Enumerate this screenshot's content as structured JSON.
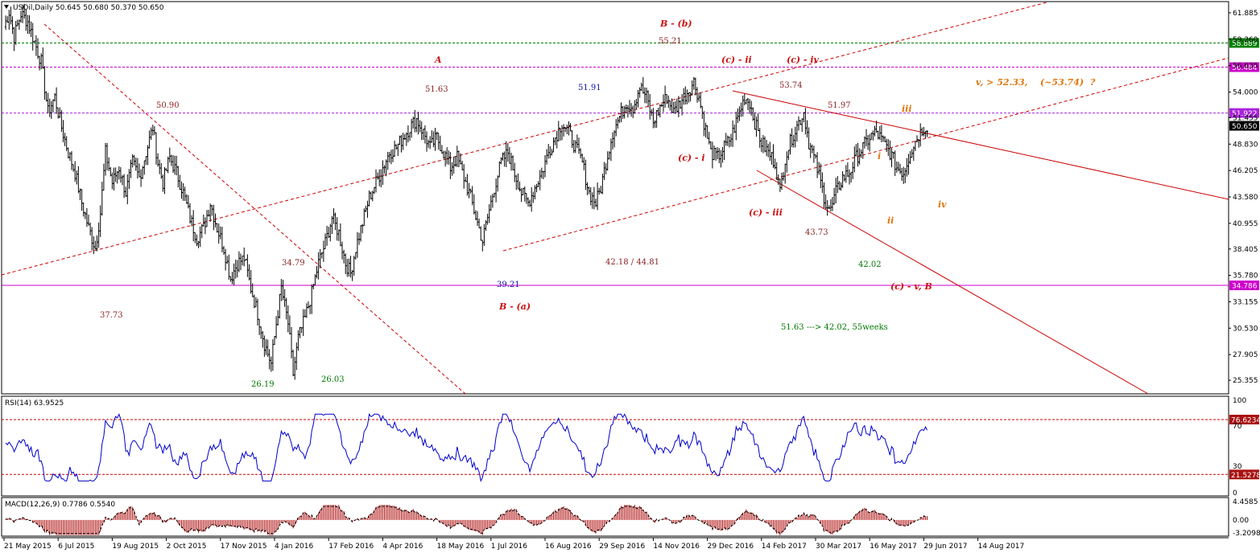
{
  "header": {
    "main_title": "USOil,Daily  50.645 50.680 50.370 50.650",
    "rsi_title": "RSI(14) 63.9525",
    "macd_title": "MACD(12,26,9) 0.7786 0.5540"
  },
  "colors": {
    "price": "#000000",
    "level_green": "#008000",
    "level_magenta": "#cc00cc",
    "level_purple": "#aa22dd",
    "trend_red": "#cc0000",
    "ann_red": "#cc1111",
    "ann_dark": "#8b2222",
    "ann_blue": "#1111aa",
    "ann_green": "#007700",
    "ann_orange": "#dd7711",
    "rsi_line": "#0000cc",
    "macd_hist": "#aa0000",
    "macd_signal": "#000000"
  },
  "chart_data": [
    {
      "type": "line",
      "panel": "price",
      "symbol": "USOil,Daily",
      "ylim": [
        24.0,
        63.0
      ],
      "y_ticks": [
        "61.885",
        "59.260",
        "56.635",
        "54.000",
        "51.455",
        "48.830",
        "46.205",
        "43.580",
        "40.955",
        "38.405",
        "35.780",
        "33.155",
        "30.530",
        "27.905",
        "25.355"
      ],
      "x_ticks": [
        "21 May 2015",
        "6 Jul 2015",
        "19 Aug 2015",
        "2 Oct 2015",
        "17 Nov 2015",
        "4 Jan 2016",
        "17 Feb 2016",
        "4 Apr 2016",
        "18 May 2016",
        "1 Jul 2016",
        "16 Aug 2016",
        "29 Sep 2016",
        "14 Nov 2016",
        "29 Dec 2016",
        "14 Feb 2017",
        "30 Mar 2017",
        "16 May 2017",
        "29 Jun 2017",
        "14 Aug 2017"
      ],
      "x_tick_index": [
        0,
        32,
        64,
        96,
        128,
        160,
        192,
        224,
        256,
        288,
        320,
        352,
        384,
        416,
        448,
        480,
        512,
        544,
        576
      ],
      "price_path_anchors": [
        [
          0,
          60.5
        ],
        [
          3,
          62.0
        ],
        [
          6,
          59.5
        ],
        [
          10,
          61.8
        ],
        [
          14,
          61.0
        ],
        [
          18,
          59.0
        ],
        [
          22,
          57.0
        ],
        [
          26,
          52.0
        ],
        [
          30,
          53.5
        ],
        [
          34,
          50.5
        ],
        [
          38,
          48.0
        ],
        [
          42,
          46.0
        ],
        [
          46,
          43.0
        ],
        [
          50,
          40.5
        ],
        [
          54,
          38.5
        ],
        [
          57,
          42.0
        ],
        [
          60,
          48.0
        ],
        [
          64,
          45.0
        ],
        [
          68,
          46.5
        ],
        [
          72,
          44.0
        ],
        [
          76,
          47.0
        ],
        [
          80,
          45.5
        ],
        [
          84,
          48.0
        ],
        [
          88,
          50.5
        ],
        [
          91,
          47.0
        ],
        [
          94,
          45.0
        ],
        [
          98,
          47.5
        ],
        [
          102,
          46.0
        ],
        [
          106,
          44.0
        ],
        [
          110,
          41.5
        ],
        [
          114,
          39.5
        ],
        [
          118,
          40.5
        ],
        [
          122,
          43.0
        ],
        [
          126,
          40.5
        ],
        [
          130,
          38.5
        ],
        [
          134,
          35.5
        ],
        [
          138,
          37.0
        ],
        [
          142,
          37.5
        ],
        [
          146,
          34.5
        ],
        [
          150,
          32.0
        ],
        [
          154,
          29.0
        ],
        [
          158,
          27.0
        ],
        [
          161,
          31.0
        ],
        [
          164,
          34.5
        ],
        [
          168,
          31.0
        ],
        [
          171,
          26.0
        ],
        [
          174,
          29.5
        ],
        [
          178,
          31.5
        ],
        [
          182,
          34.0
        ],
        [
          186,
          37.0
        ],
        [
          190,
          39.0
        ],
        [
          194,
          41.5
        ],
        [
          198,
          40.0
        ],
        [
          202,
          37.0
        ],
        [
          205,
          36.0
        ],
        [
          208,
          38.5
        ],
        [
          212,
          41.0
        ],
        [
          216,
          43.5
        ],
        [
          220,
          45.0
        ],
        [
          224,
          46.5
        ],
        [
          228,
          48.0
        ],
        [
          232,
          48.5
        ],
        [
          236,
          49.5
        ],
        [
          240,
          50.5
        ],
        [
          244,
          51.3
        ],
        [
          248,
          50.0
        ],
        [
          252,
          48.5
        ],
        [
          256,
          49.5
        ],
        [
          260,
          48.0
        ],
        [
          264,
          46.5
        ],
        [
          268,
          47.5
        ],
        [
          272,
          45.5
        ],
        [
          276,
          43.5
        ],
        [
          280,
          41.0
        ],
        [
          283,
          39.2
        ],
        [
          286,
          41.5
        ],
        [
          290,
          44.5
        ],
        [
          294,
          47.0
        ],
        [
          298,
          48.0
        ],
        [
          302,
          46.0
        ],
        [
          306,
          44.0
        ],
        [
          310,
          43.0
        ],
        [
          314,
          44.5
        ],
        [
          318,
          46.0
        ],
        [
          322,
          48.0
        ],
        [
          326,
          49.5
        ],
        [
          330,
          51.0
        ],
        [
          334,
          50.0
        ],
        [
          338,
          48.5
        ],
        [
          342,
          47.0
        ],
        [
          346,
          44.0
        ],
        [
          350,
          43.0
        ],
        [
          353,
          44.5
        ],
        [
          356,
          47.0
        ],
        [
          360,
          50.0
        ],
        [
          364,
          51.5
        ],
        [
          368,
          53.0
        ],
        [
          372,
          52.5
        ],
        [
          376,
          54.5
        ],
        [
          380,
          53.5
        ],
        [
          384,
          51.0
        ],
        [
          388,
          52.5
        ],
        [
          392,
          53.5
        ],
        [
          396,
          52.0
        ],
        [
          400,
          53.0
        ],
        [
          404,
          54.0
        ],
        [
          408,
          55.0
        ],
        [
          411,
          53.5
        ],
        [
          414,
          51.0
        ],
        [
          418,
          48.0
        ],
        [
          422,
          47.5
        ],
        [
          426,
          48.5
        ],
        [
          430,
          49.5
        ],
        [
          434,
          51.5
        ],
        [
          438,
          53.5
        ],
        [
          441,
          53.0
        ],
        [
          444,
          51.0
        ],
        [
          448,
          49.0
        ],
        [
          452,
          48.0
        ],
        [
          456,
          47.0
        ],
        [
          459,
          44.0
        ],
        [
          462,
          47.5
        ],
        [
          466,
          49.5
        ],
        [
          470,
          51.0
        ],
        [
          473,
          52.0
        ],
        [
          476,
          49.0
        ],
        [
          480,
          47.0
        ],
        [
          483,
          45.0
        ],
        [
          486,
          43.0
        ],
        [
          489,
          42.2
        ],
        [
          492,
          44.0
        ],
        [
          496,
          45.5
        ],
        [
          500,
          46.0
        ],
        [
          504,
          47.5
        ],
        [
          508,
          48.5
        ],
        [
          512,
          49.5
        ],
        [
          516,
          50.0
        ],
        [
          520,
          49.0
        ],
        [
          524,
          48.0
        ],
        [
          528,
          46.5
        ],
        [
          532,
          46.0
        ],
        [
          536,
          48.0
        ],
        [
          540,
          49.5
        ],
        [
          544,
          50.5
        ],
        [
          546,
          50.65
        ]
      ],
      "horizontal_levels": [
        {
          "value": 58.889,
          "label": "58.889",
          "color": "#008000"
        },
        {
          "value": 56.484,
          "label": "56.484",
          "color": "#cc00cc"
        },
        {
          "value": 51.922,
          "label": "51.922",
          "color": "#aa22dd"
        },
        {
          "value": 50.65,
          "label": "50.650",
          "color": "#000000"
        },
        {
          "value": 34.786,
          "label": "34.786",
          "color": "#cc00cc"
        }
      ],
      "annotations": [
        {
          "text": "B - (b)",
          "style": "red"
        },
        {
          "text": "55.21",
          "style": "dark"
        },
        {
          "text": "A",
          "style": "red"
        },
        {
          "text": "51.63",
          "style": "dark"
        },
        {
          "text": "51.91",
          "style": "blue"
        },
        {
          "text": "50.90",
          "style": "dark"
        },
        {
          "text": "(c) - ii",
          "style": "red"
        },
        {
          "text": "(c) - iv",
          "style": "red"
        },
        {
          "text": "53.74",
          "style": "dark"
        },
        {
          "text": "51.97",
          "style": "dark"
        },
        {
          "text": "iii",
          "style": "orange"
        },
        {
          "text": "v, > 52.33,",
          "style": "orange"
        },
        {
          "text": "(~53.74)",
          "style": "orange"
        },
        {
          "text": "?",
          "style": "orange"
        },
        {
          "text": "(c) - i",
          "style": "red"
        },
        {
          "text": "(c) - iii",
          "style": "red"
        },
        {
          "text": "43.73",
          "style": "dark"
        },
        {
          "text": "i",
          "style": "orange"
        },
        {
          "text": "ii",
          "style": "orange"
        },
        {
          "text": "iv",
          "style": "orange"
        },
        {
          "text": "42.18 / 44.81",
          "style": "dark"
        },
        {
          "text": "42.02",
          "style": "green"
        },
        {
          "text": "34.79",
          "style": "dark"
        },
        {
          "text": "39.21",
          "style": "blue"
        },
        {
          "text": "(c) - v, B",
          "style": "red"
        },
        {
          "text": "B - (a)",
          "style": "red"
        },
        {
          "text": "37.73",
          "style": "dark"
        },
        {
          "text": "51.63 ---> 42.02,  55weeks",
          "style": "green"
        },
        {
          "text": "26.19",
          "style": "green"
        },
        {
          "text": "26.03",
          "style": "green"
        }
      ]
    },
    {
      "type": "line",
      "panel": "rsi",
      "name": "RSI(14)",
      "ylim": [
        0,
        100
      ],
      "y_ticks": [
        "100",
        "70",
        "30",
        "0"
      ],
      "levels": [
        {
          "value": 76.6234,
          "label": "76.6234"
        },
        {
          "value": 21.5278,
          "label": "21.5278"
        }
      ]
    },
    {
      "type": "bar",
      "panel": "macd",
      "name": "MACD(12,26,9)",
      "ylim": [
        -3.2098,
        4.4585
      ],
      "y_ticks": [
        "4.4585",
        "0.00",
        "-3.2098"
      ]
    }
  ]
}
